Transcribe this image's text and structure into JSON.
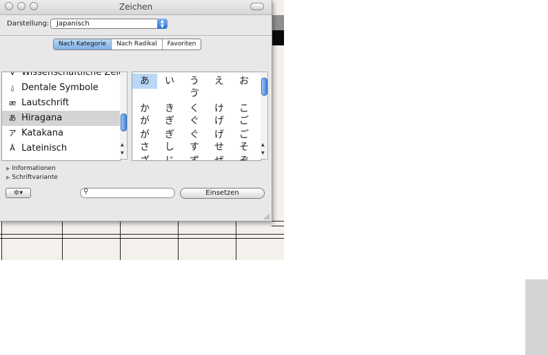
{
  "window": {
    "title": "Zeichen"
  },
  "toolbar": {
    "darstellung_label": "Darstellung:",
    "darstellung_value": "Japanisch"
  },
  "segments": [
    {
      "label": "Nach Kategorie",
      "active": true
    },
    {
      "label": "Nach Radikal",
      "active": false
    },
    {
      "label": "Favoriten",
      "active": false
    }
  ],
  "categories": [
    {
      "glyph": "∀",
      "label": "Wissenschaftliche Zeichen",
      "state": "cut"
    },
    {
      "glyph": "⍙",
      "label": "Dentale Symbole",
      "state": ""
    },
    {
      "glyph": "æ",
      "label": "Lautschrift",
      "state": ""
    },
    {
      "glyph": "あ",
      "label": "Hiragana",
      "state": "selected"
    },
    {
      "glyph": "ア",
      "label": "Katakana",
      "state": ""
    },
    {
      "glyph": "Ā",
      "label": "Lateinisch",
      "state": ""
    }
  ],
  "characters": [
    [
      "あ",
      "い",
      "う",
      "え",
      "お"
    ],
    [
      "",
      "",
      "ゔ",
      "",
      ""
    ],
    [
      "か",
      "き",
      "く",
      "け",
      "こ"
    ],
    [
      "が",
      "ぎ",
      "ぐ",
      "げ",
      "ご"
    ],
    [
      "が",
      "ぎ",
      "ぐ",
      "げ",
      "ご"
    ],
    [
      "さ",
      "し",
      "す",
      "せ",
      "そ"
    ],
    [
      "ざ",
      "じ",
      "ず",
      "ぜ",
      "ぞ"
    ]
  ],
  "disclosures": {
    "info": "Informationen",
    "font_variant": "Schriftvariante"
  },
  "bottom": {
    "gear_label": "✲▾",
    "search_placeholder": "",
    "insert_label": "Einsetzen"
  },
  "colors": {
    "selection_blue": "#b9d7f6",
    "accent_blue": "#3d86e0",
    "list_selected": "#d4d4d4"
  }
}
